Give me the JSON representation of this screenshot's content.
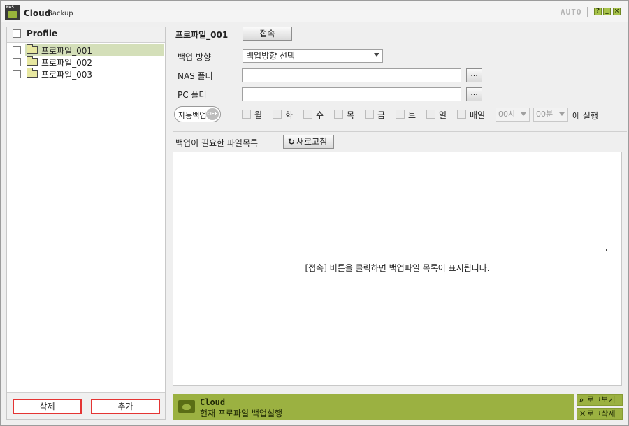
{
  "titlebar": {
    "logo_text": "NAS",
    "title": "Cloud",
    "title_sub": "Backup",
    "mode": "AUTO",
    "help_btn": "?",
    "min_btn": "_",
    "close_btn": "×"
  },
  "sidebar": {
    "header": "Profile",
    "items": [
      {
        "label": "프로파일_001",
        "selected": true
      },
      {
        "label": "프로파일_002",
        "selected": false
      },
      {
        "label": "프로파일_003",
        "selected": false
      }
    ],
    "delete_label": "삭제",
    "add_label": "추가"
  },
  "profile": {
    "name": "프로파일_001",
    "connect_label": "접속"
  },
  "form": {
    "direction_label": "백업 방향",
    "direction_value": "백업방향 선택",
    "nas_label": "NAS 폴더",
    "nas_value": "",
    "pc_label": "PC 폴더",
    "pc_value": "",
    "browse_label": "...",
    "auto_backup_label": "자동백업",
    "auto_backup_state": "OFF",
    "days": [
      "월",
      "화",
      "수",
      "목",
      "금",
      "토",
      "일",
      "매일"
    ],
    "hour_value": "00시",
    "minute_value": "00분",
    "run_label": "에 실행"
  },
  "file_list": {
    "title": "백업이 필요한 파일목록",
    "refresh_label": "새로고침",
    "empty_message": "[접속] 버튼을 클릭하면 백업파일 목록이 표시됩니다."
  },
  "status": {
    "title": "Cloud",
    "message": "현재 프로파일 백업실행",
    "log_view_label": "로그보기",
    "log_delete_label": "로그삭제"
  },
  "colors": {
    "accent_green": "#9bb141",
    "selected_row": "#d4dfb9",
    "button_border_red": "#e43534"
  }
}
